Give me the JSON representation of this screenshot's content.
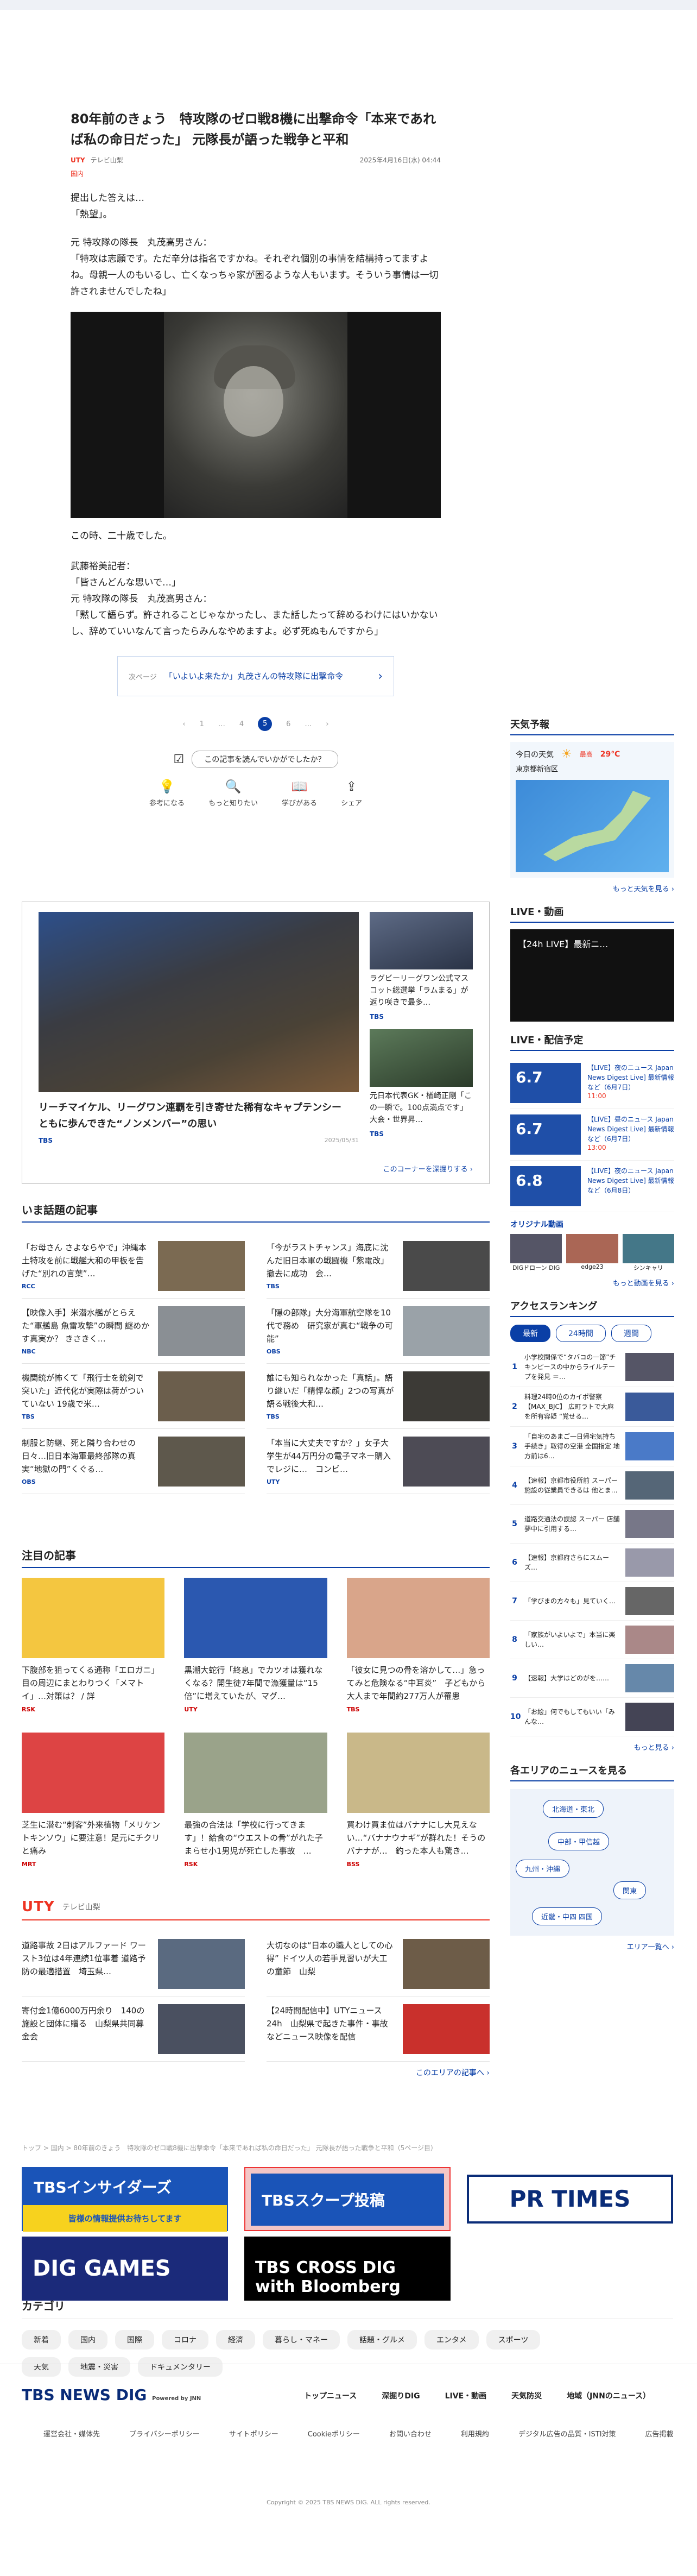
{
  "article": {
    "title": "80年前のきょう　特攻隊のゼロ戦8機に出撃命令「本来であれば私の命日だった」 元隊長が語った戦争と平和",
    "source_logo": "UTY",
    "source_name": "テレビ山梨",
    "date": "2025年4月16日(水) 04:44",
    "category": "国内",
    "paragraphs": [
      "提出した答えは…\n「熱望」。",
      "元 特攻隊の隊長　丸茂高男さん：\n「特攻は志願です。ただ辛分は指名ですかね。それぞれ個別の事情を結構持ってますよね。母親一人のもいるし、亡くなっちゃ家が困るような人もいます。そういう事情は一切許されませんでしたね」",
      "この時、二十歳でした。",
      "武藤裕美記者：\n「皆さんどんな思いで…」\n元 特攻隊の隊長　丸茂高男さん：\n「黙して語らず。許されることじゃなかったし、また話したって辞めるわけにはいかないし、辞めていいなんて言ったらみんなやめますよ。必ず死ぬもんですから」"
    ],
    "next_label": "次ページ",
    "next_link": "「いよいよ来たか」丸茂さんの特攻隊に出撃命令",
    "pager": [
      "‹",
      "1",
      "…",
      "4",
      "5",
      "6",
      "…",
      "›"
    ],
    "pager_current": "5",
    "feedback_question": "この記事を読んでいかがでしたか？",
    "reactions": [
      "参考になる",
      "もっと知りたい",
      "学びがある",
      "シェア"
    ]
  },
  "featured": {
    "main_caption": "リーチマイケル、リーグワン連覇を引き寄せた稀有なキャプテンシー　ともに歩んできた“ノンメンバー”の思い",
    "main_source": "TBS",
    "main_date": "2025/05/31",
    "subs": [
      {
        "caption": "ラグビーリーグワン公式マスコット総選挙「ラムまる」が返り咲きで最多…",
        "source": "TBS"
      },
      {
        "caption": "元日本代表GK・楢崎正剛「この一瞬で。100点満点です」大会・世界昇…",
        "source": "TBS"
      }
    ],
    "more": "このコーナーを深掘りする ›"
  },
  "topics": {
    "title": "いま話題の記事",
    "items": [
      {
        "text": "「お母さん さよならやで」沖縄本土特攻を前に戦艦大和の甲板を告げた“別れの言葉”…",
        "src": "RCC"
      },
      {
        "text": "「今がラストチャンス」海底に沈んだ旧日本軍の戦闘機「紫電改」撤去に成功　会…",
        "src": "TBS"
      },
      {
        "text": "【映像入手】米潜水艦がとらえた“軍艦島 魚雷攻撃”の瞬間 謎めかす真実か？ きさきく…",
        "src": "NBC"
      },
      {
        "text": "「隠の部隊」大分海軍航空隊を10代で務め　研究家が真む“戦争の可能”",
        "src": "OBS"
      },
      {
        "text": "機関銃が怖くて「飛行士を銃剣で突いた」近代化が実際は荷がついていない 19歳で米…",
        "src": "TBS"
      },
      {
        "text": "誰にも知られなかった「真話」。語り継いだ「精悍な顔」2つの写真が語る戦後大和…",
        "src": "TBS"
      },
      {
        "text": "制服と防継、死と隣り合わせの日々…旧日本海軍最終部隊の真実“地獄の門”くぐる…",
        "src": "OBS"
      },
      {
        "text": "「本当に大丈夫ですか？」女子大学生が44万円分の電子マネー購入でレジに…　コンビ…",
        "src": "UTY"
      }
    ]
  },
  "notable": {
    "title": "注目の記事",
    "items": [
      {
        "text": "下腹部を狙ってくる通称「エロガニ」目の周辺にまとわりつく「メマトイ」…対策は？ / 詳",
        "src": "RSK"
      },
      {
        "text": "黒潮大蛇行「終息」でカツオは獲れなくなる？開生徒7年間で漁獲量は“15倍”に増えていたが、マグ…",
        "src": "UTY"
      },
      {
        "text": "「彼女に見つの骨を溶かして…」急ってみと危険なる“中耳炎”　子どもから大人まで年間約277万人が罹患",
        "src": "TBS"
      },
      {
        "text": "芝生に潜む“刺客”外来植物「メリケントキンソウ」に要注意！足元にチクリと痛み",
        "src": "MRT"
      },
      {
        "text": "最強の合法は「学校に行ってきます」！給食の“ウエストの骨”がれた子まらせ小1男児が死亡した事故　…",
        "src": "RSK"
      },
      {
        "text": "買わけ買ま位はバナナにし大見えない…“バナナウナギ”が群れた！そうのバナナが…　釣った本人も驚き…",
        "src": "BSS"
      }
    ]
  },
  "uty": {
    "logo": "UTY",
    "sub": "テレビ山梨",
    "items": [
      {
        "text": "道路事故 2日はアルファード ワースト3位は4年連続1位事着 道路予防の最適措置　埼玉県…"
      },
      {
        "text": "大切なのは“日本の職人としての心得” ドイツ人の若手見習いが大工の童節　山梨"
      },
      {
        "text": "寄付金1億6000万円余り　140の施設と団体に贈る　山梨県共同募金会"
      },
      {
        "text": "【24時間配信中】UTYニュース24h　山梨県で起きた事件・事故などニュース映像を配信"
      }
    ],
    "more": "このエリアの記事へ ›"
  },
  "banners": [
    "TBSインサイダーズ",
    "皆様の情報提供お待ちしてます",
    "TBSスクープ投稿",
    "PR TIMES",
    "DIG GAMES",
    "TBS CROSS DIG with Bloomberg"
  ],
  "breadcrumb": "トップ > 国内 > 80年前のきょう　特攻隊のゼロ戦8機に出撃命令「本来であれば私の命日だった」 元隊長が語った戦争と平和（5ページ目）",
  "categories": {
    "title": "カテゴリ",
    "items": [
      "新着",
      "国内",
      "国際",
      "コロナ",
      "経済",
      "暮らし・マネー",
      "話題・グルメ",
      "エンタメ",
      "スポーツ",
      "天気",
      "地震・災害",
      "ドキュメンタリー"
    ]
  },
  "footer": {
    "brand": "TBS NEWS DIG",
    "brand_sub": "Powered by JNN",
    "nav": [
      "トップニュース",
      "深掘りDIG",
      "LIVE・動画",
      "天気防災",
      "地域（JNNのニュース）"
    ],
    "links": [
      "運営会社・媒体先",
      "プライバシーポリシー",
      "サイトポリシー",
      "Cookieポリシー",
      "お問い合わせ",
      "利用規約",
      "デジタル広告の品質・ISTI対策",
      "広告掲載"
    ],
    "copyright": "Copyright © 2025 TBS NEWS DIG. ALL rights reserved."
  },
  "sidebar": {
    "weather": {
      "title": "天気予報",
      "today": "今日の天気",
      "place": "東京都新宿区",
      "hi_label": "最高",
      "hi": "29℃",
      "more": "もっと天気を見る ›"
    },
    "live": {
      "title": "LIVE・動画",
      "player_label": "【24h LIVE】最新ニ…"
    },
    "schedule": {
      "title": "LIVE・配信予定",
      "items": [
        {
          "date": "6.7",
          "text": "【LIVE】夜のニュース Japan News Digest Live] 最新情報など（6月7日）",
          "time": "11:00"
        },
        {
          "date": "6.7",
          "text": "【LIVE】昼のニュース Japan News Digest Live] 最新情報など（6月7日）",
          "time": "13:00"
        },
        {
          "date": "6.8",
          "text": "【LIVE】夜のニュース Japan News Digest Live] 最新情報など（6月8日）",
          "time": ""
        }
      ],
      "original": "オリジナル動画",
      "orig_items": [
        "DIGドローン DIG",
        "edge23",
        "シンキャリ"
      ],
      "more": "もっと動画を見る ›"
    },
    "ranking": {
      "title": "アクセスランキング",
      "tabs": [
        "最新",
        "24時間",
        "週間"
      ],
      "items": [
        "小学校関係で“タバコの一節”チキンピースの中からライルテープを発見  ＝…",
        "料理24時0位のカイポ警察【MAX_BJC】 広町ラトで大麻を所有容疑 “覚せる…",
        "「自宅のあまご一日帰宅気持ち手続き」取得の空港 全国指定 地方前は6…",
        "【速報】京都市役所前 スーパー施設の従業員できるは 他とま…",
        "道路交通法の誤認 スーパー 店舗 夢中に引用する…",
        "【速報】京都府さらにスムーズ…",
        "「学びまの方々も」見ていく…",
        "「家族がいよいよで」本当に楽しい…",
        "【速報】大学はどのがを……",
        "「お絵」何でもしてもいい「みんな…"
      ],
      "more": "もっと見る ›"
    },
    "area": {
      "title": "各エリアのニュースを見る",
      "pills": [
        "北海道・東北",
        "中部・甲信越",
        "九州・沖縄",
        "関東",
        "近畿・中四 四国"
      ],
      "more": "エリア一覧へ ›"
    }
  }
}
